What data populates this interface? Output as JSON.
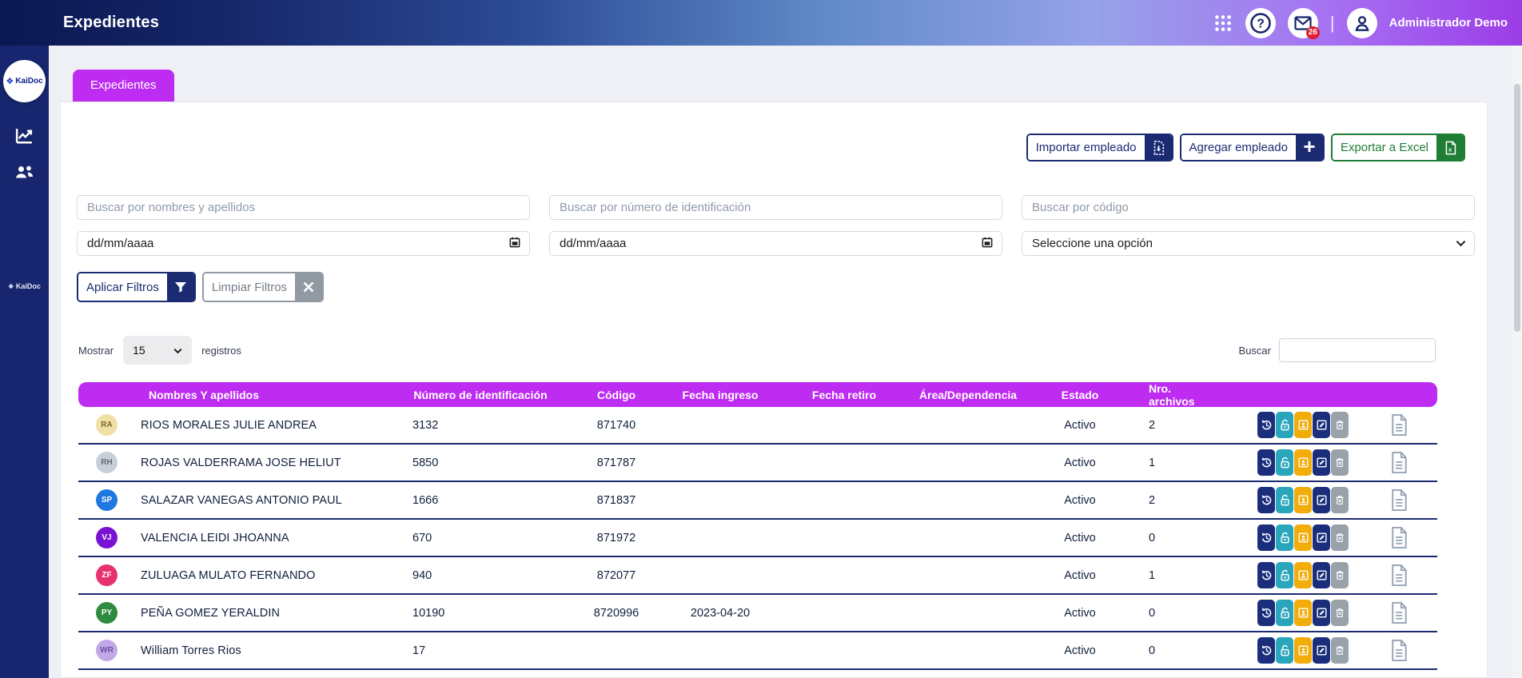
{
  "header": {
    "title": "Expedientes",
    "user": "Administrador Demo",
    "mail_badge": "26",
    "icons": [
      "apps-grid-icon",
      "help-icon",
      "mail-icon",
      "user-icon"
    ]
  },
  "sidebar": {
    "logo_text": "KaiDoc",
    "footer_logo_text": "KaiDoc",
    "icons": [
      "line-chart-icon",
      "users-icon"
    ]
  },
  "tab": {
    "label": "Expedientes"
  },
  "toolbar": {
    "import_label": "Importar empleado",
    "add_label": "Agregar empleado",
    "export_label": "Exportar a Excel"
  },
  "filters": {
    "search_name_placeholder": "Buscar por nombres y apellidos",
    "search_id_placeholder": "Buscar por número de identificación",
    "search_code_placeholder": "Buscar por código",
    "date_from_value": "dd/mm/aaaa",
    "date_to_value": "dd/mm/aaaa",
    "select_value": "Seleccione una opción",
    "apply_label": "Aplicar Filtros",
    "clear_label": "Limpiar Filtros"
  },
  "list_controls": {
    "show_label": "Mostrar",
    "page_size": "15",
    "records_label": "registros",
    "search_label": "Buscar",
    "search_value": ""
  },
  "table": {
    "columns": [
      "Nombres Y apellidos",
      "Número de identificación",
      "Código",
      "Fecha ingreso",
      "Fecha retiro",
      "Área/Dependencia",
      "Estado",
      "Nro. archivos"
    ],
    "row_actions": [
      "history",
      "unlock",
      "contact-card",
      "edit",
      "delete",
      "document"
    ],
    "rows": [
      {
        "initials": "RA",
        "avatar_bg": "#f1e0a6",
        "avatar_fg": "#7c6a2b",
        "name": "RIOS MORALES JULIE ANDREA",
        "id_number": "3132",
        "code": "871740",
        "fecha_ingreso": "",
        "fecha_retiro": "",
        "area": "",
        "estado": "Activo",
        "files": "2"
      },
      {
        "initials": "RH",
        "avatar_bg": "#c9cfd8",
        "avatar_fg": "#5f6875",
        "name": "ROJAS VALDERRAMA JOSE HELIUT",
        "id_number": "5850",
        "code": "871787",
        "fecha_ingreso": "",
        "fecha_retiro": "",
        "area": "",
        "estado": "Activo",
        "files": "1"
      },
      {
        "initials": "SP",
        "avatar_bg": "#1e78e0",
        "avatar_fg": "#ffffff",
        "name": "SALAZAR VANEGAS ANTONIO PAUL",
        "id_number": "1666",
        "code": "871837",
        "fecha_ingreso": "",
        "fecha_retiro": "",
        "area": "",
        "estado": "Activo",
        "files": "2"
      },
      {
        "initials": "VJ",
        "avatar_bg": "#7a12d4",
        "avatar_fg": "#ffffff",
        "name": "VALENCIA LEIDI JHOANNA",
        "id_number": "670",
        "code": "871972",
        "fecha_ingreso": "",
        "fecha_retiro": "",
        "area": "",
        "estado": "Activo",
        "files": "0"
      },
      {
        "initials": "ZF",
        "avatar_bg": "#e8326e",
        "avatar_fg": "#ffffff",
        "name": "ZULUAGA MULATO FERNANDO",
        "id_number": "940",
        "code": "872077",
        "fecha_ingreso": "",
        "fecha_retiro": "",
        "area": "",
        "estado": "Activo",
        "files": "1"
      },
      {
        "initials": "PY",
        "avatar_bg": "#2e8b3f",
        "avatar_fg": "#ffffff",
        "name": "PEÑA GOMEZ YERALDIN",
        "id_number": "10190",
        "code": "8720996",
        "fecha_ingreso": "2023-04-20",
        "fecha_retiro": "",
        "area": "",
        "estado": "Activo",
        "files": "0"
      },
      {
        "initials": "WR",
        "avatar_bg": "#c3a8e8",
        "avatar_fg": "#6b4fa5",
        "name": "William Torres Rios",
        "id_number": "17",
        "code": "",
        "fecha_ingreso": "",
        "fecha_retiro": "",
        "area": "",
        "estado": "Activo",
        "files": "0"
      }
    ]
  }
}
